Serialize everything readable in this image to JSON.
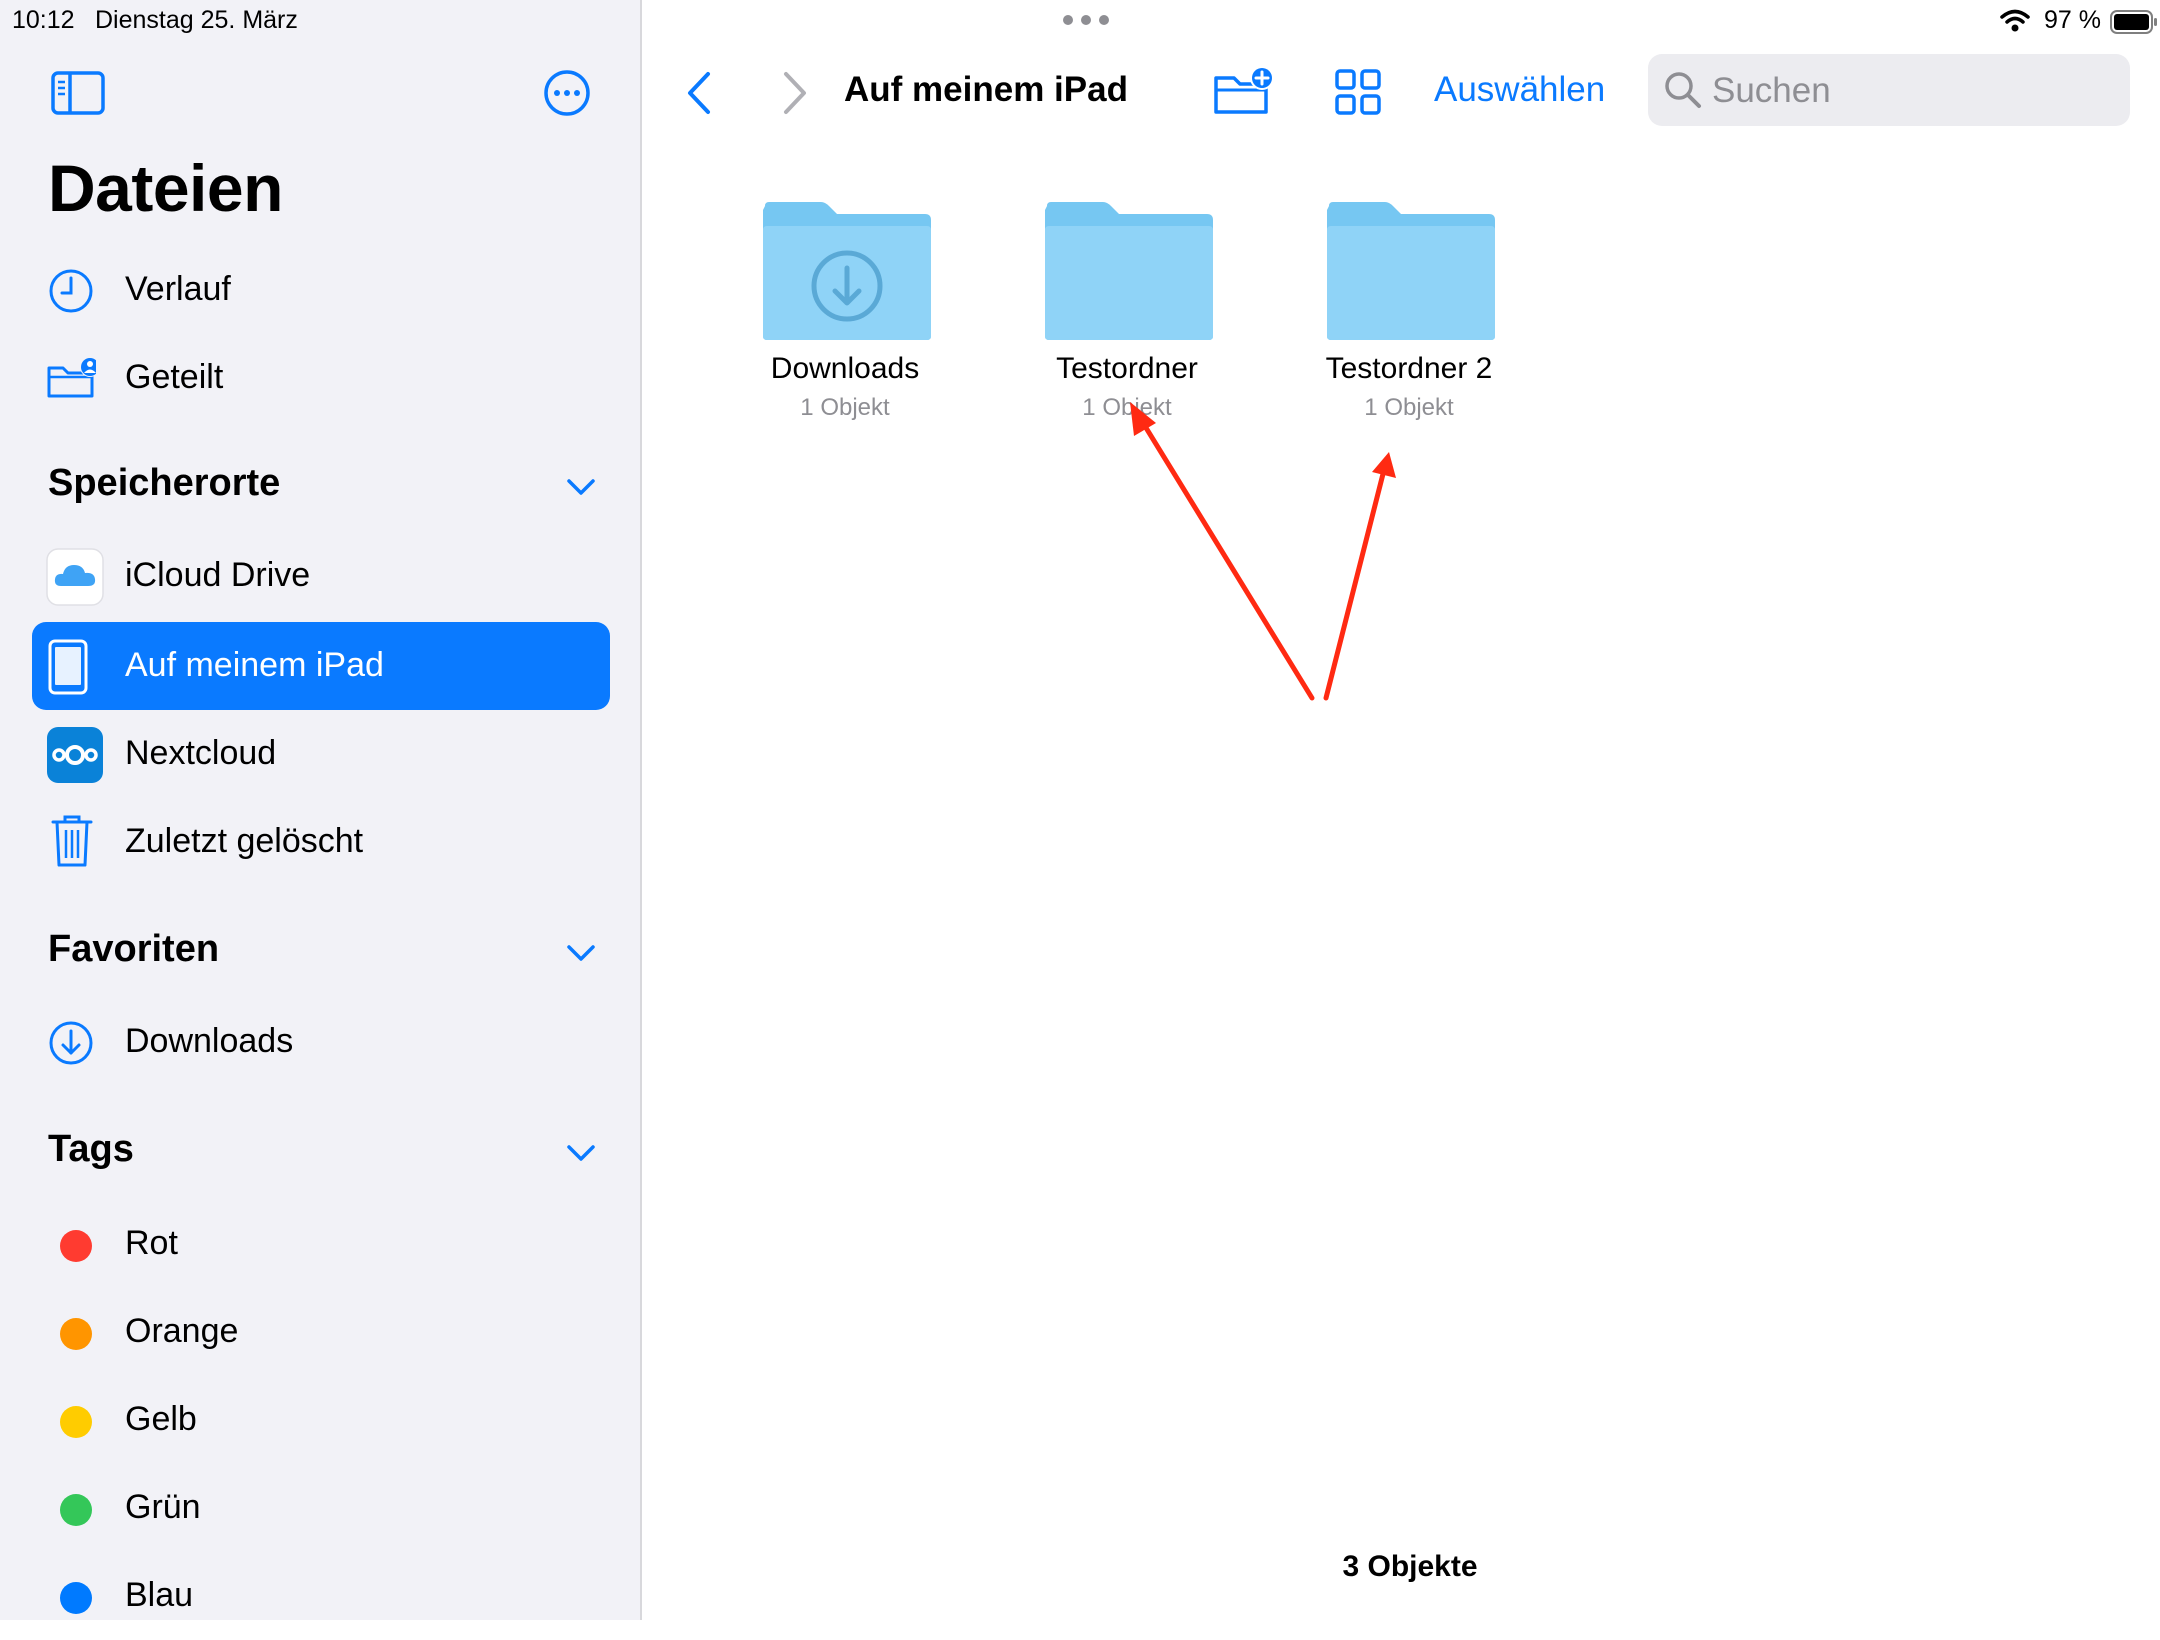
{
  "status_bar": {
    "time": "10:12",
    "date": "Dienstag 25. März",
    "battery": "97 %"
  },
  "sidebar": {
    "title": "Dateien",
    "quick": [
      {
        "label": "Verlauf",
        "icon": "clock-icon"
      },
      {
        "label": "Geteilt",
        "icon": "shared-folder-icon"
      }
    ],
    "locations_header": "Speicherorte",
    "locations": [
      {
        "label": "iCloud Drive",
        "icon": "icloud-icon"
      },
      {
        "label": "Auf meinem iPad",
        "icon": "ipad-icon",
        "selected": true
      },
      {
        "label": "Nextcloud",
        "icon": "nextcloud-icon"
      },
      {
        "label": "Zuletzt gelöscht",
        "icon": "trash-icon"
      }
    ],
    "favorites_header": "Favoriten",
    "favorites": [
      {
        "label": "Downloads",
        "icon": "download-icon"
      }
    ],
    "tags_header": "Tags",
    "tags": [
      {
        "label": "Rot",
        "color": "#ff3b30"
      },
      {
        "label": "Orange",
        "color": "#ff9500"
      },
      {
        "label": "Gelb",
        "color": "#ffcc00"
      },
      {
        "label": "Grün",
        "color": "#34c759"
      },
      {
        "label": "Blau",
        "color": "#007aff"
      }
    ]
  },
  "toolbar": {
    "location_title": "Auf meinem iPad",
    "select_label": "Auswählen",
    "search_placeholder": "Suchen"
  },
  "folders": [
    {
      "name": "Downloads",
      "count": "1 Objekt",
      "icon": "download-folder-icon"
    },
    {
      "name": "Testordner",
      "count": "1 Objekt",
      "icon": "folder-icon"
    },
    {
      "name": "Testordner 2",
      "count": "1 Objekt",
      "icon": "folder-icon"
    }
  ],
  "footer": {
    "item_count": "3 Objekte"
  },
  "colors": {
    "accent": "#0a7aff",
    "sidebar_bg": "#f2f2f7",
    "folder_front": "#8fd3f7",
    "folder_back": "#76c7f2",
    "annotation": "#ff2a12"
  }
}
